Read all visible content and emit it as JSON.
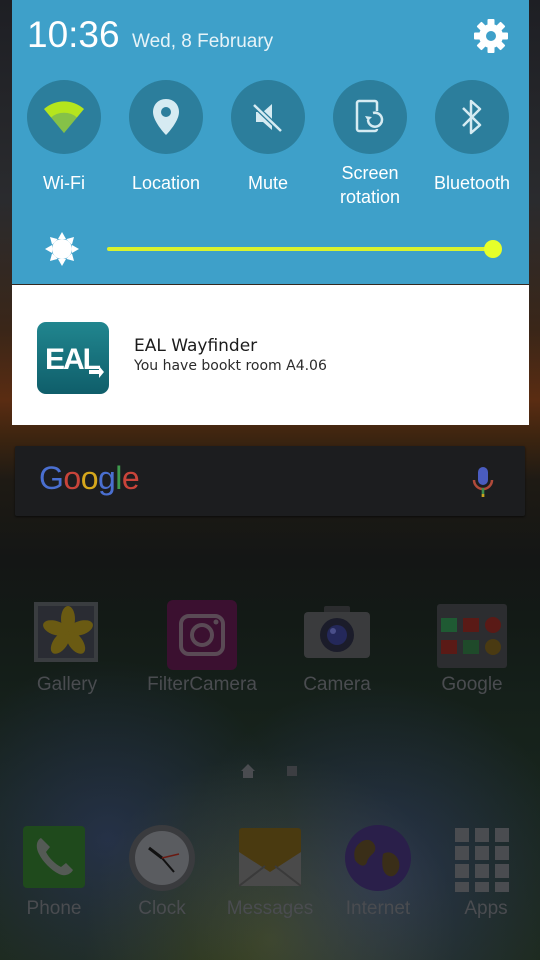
{
  "status": {
    "time": "10:36",
    "date": "Wed, 8 February"
  },
  "quick_settings": {
    "tiles": [
      {
        "label": "Wi-Fi",
        "icon": "wifi-icon"
      },
      {
        "label": "Location",
        "icon": "location-icon"
      },
      {
        "label": "Mute",
        "icon": "mute-icon"
      },
      {
        "label": "Screen rotation",
        "icon": "screen-rotation-icon"
      },
      {
        "label": "Bluetooth",
        "icon": "bluetooth-icon"
      }
    ],
    "brightness_level": 1.0,
    "colors": {
      "panel": "#3ea0c9",
      "tile": "#2c7e9c",
      "active": "#b5e51d",
      "slider": "#d9f22f"
    }
  },
  "notification": {
    "app_name": "EAL Wayfinder",
    "message": "You have bookt room A4.06",
    "icon_text": "EAL"
  },
  "search": {
    "logo": "Google"
  },
  "home": {
    "apps": [
      {
        "label": "Gallery"
      },
      {
        "label": "FilterCamera"
      },
      {
        "label": "Camera"
      },
      {
        "label": "Google"
      }
    ],
    "dock": [
      {
        "label": "Phone"
      },
      {
        "label": "Clock"
      },
      {
        "label": "Messages"
      },
      {
        "label": "Internet"
      },
      {
        "label": "Apps"
      }
    ]
  }
}
